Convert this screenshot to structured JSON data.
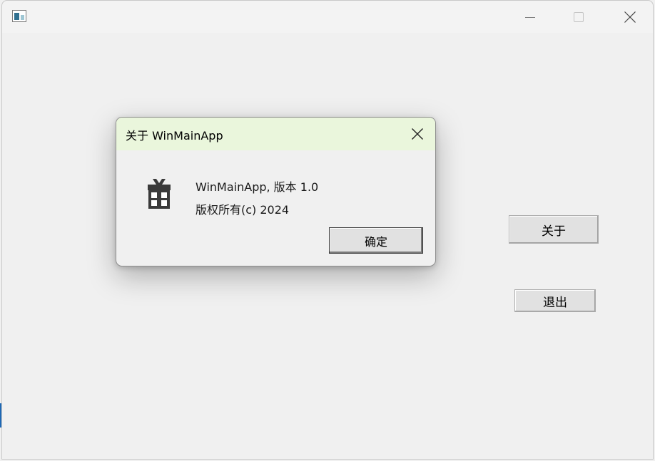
{
  "main_window": {
    "title": "",
    "icon": "app-window-icon",
    "controls": [
      "minimize-icon",
      "maximize-icon",
      "close-icon"
    ],
    "buttons": {
      "about_label": "关于",
      "exit_label": "退出"
    }
  },
  "about_dialog": {
    "title": "关于 WinMainApp",
    "icon": "gift-icon",
    "version_text": "WinMainApp, 版本 1.0",
    "copyright_text": "版权所有(c) 2024",
    "ok_label": "确定"
  }
}
